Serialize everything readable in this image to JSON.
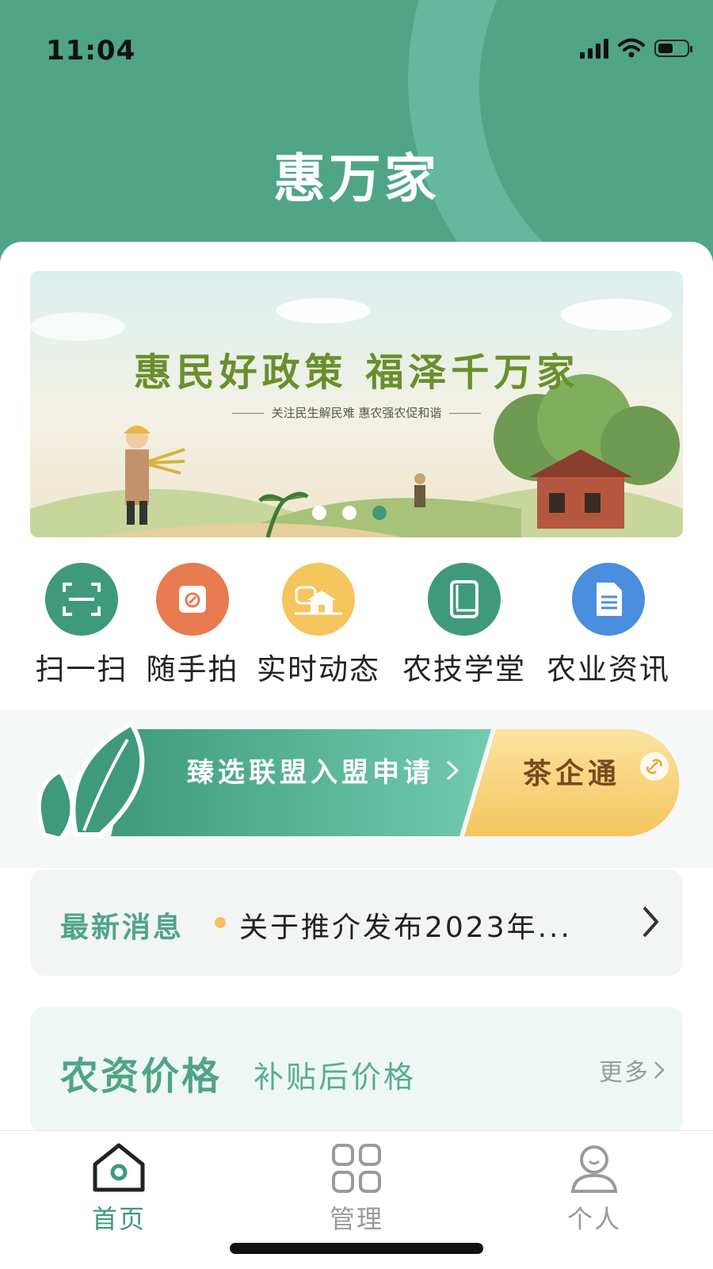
{
  "status_bar": {
    "time": "11:04"
  },
  "header": {
    "title": "惠万家"
  },
  "banner": {
    "headline": "惠民好政策  福泽千万家",
    "tagline": "关注民生解民难 惠农强农促和谐",
    "carousel_active_index": 2,
    "carousel_count": 3
  },
  "quick_actions": [
    {
      "label": "扫一扫",
      "icon": "scan-icon",
      "color": "#3e9a7a"
    },
    {
      "label": "随手拍",
      "icon": "camera-bag-icon",
      "color": "#e87a4f"
    },
    {
      "label": "实时动态",
      "icon": "house-scene-icon",
      "color": "#f5c55e"
    },
    {
      "label": "农技学堂",
      "icon": "book-icon",
      "color": "#3e9a7a"
    },
    {
      "label": "农业资讯",
      "icon": "document-icon",
      "color": "#4a8ee0"
    }
  ],
  "promo": {
    "left_label": "臻选联盟入盟申请",
    "right_label": "茶企通",
    "leaf_icon": "leaf-icon",
    "link_icon": "link-icon"
  },
  "notice": {
    "label": "最新消息",
    "text": "关于推介发布2023年..."
  },
  "price_section": {
    "title": "农资价格",
    "subtitle": "补贴后价格",
    "more": "更多"
  },
  "tabbar": {
    "items": [
      {
        "label": "首页",
        "icon": "home-icon",
        "active": true
      },
      {
        "label": "管理",
        "icon": "grid-icon",
        "active": false
      },
      {
        "label": "个人",
        "icon": "user-icon",
        "active": false
      }
    ]
  },
  "colors": {
    "brand": "#4fa585",
    "accent_yellow": "#f5c063",
    "tab_active": "#3e9a7a",
    "tab_inactive": "#9a9a9a"
  }
}
